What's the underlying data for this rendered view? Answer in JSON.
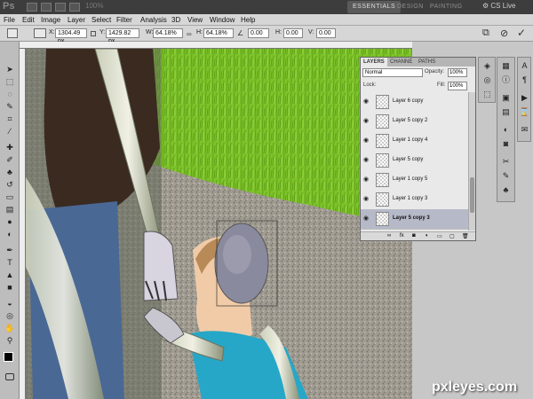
{
  "app": {
    "logo": "Ps",
    "zoom": "100%"
  },
  "workspaces": [
    "ESSENTIALS",
    "DESIGN",
    "PAINTING"
  ],
  "cs_live": "CS Live",
  "menus": [
    "File",
    "Edit",
    "Image",
    "Layer",
    "Select",
    "Filter",
    "Analysis",
    "3D",
    "View",
    "Window",
    "Help"
  ],
  "options": {
    "x_label": "X:",
    "x_value": "1304.49 px",
    "y_label": "Y:",
    "y_value": "1429.82 px",
    "w_label": "W:",
    "w_value": "64.18%",
    "h_label": "H:",
    "h_value": "64.18%",
    "rot_value": "0.00",
    "hskew_label": "H:",
    "hskew_value": "0.00",
    "vskew_label": "V:",
    "vskew_value": "0.00"
  },
  "layers_panel": {
    "tabs": [
      "LAYERS",
      "CHANNE",
      "PATHS"
    ],
    "blend_mode": "Normal",
    "opacity_label": "Opacity:",
    "opacity_value": "100%",
    "lock_label": "Lock:",
    "fill_label": "Fill:",
    "fill_value": "100%",
    "layers": [
      "Layer 6 copy",
      "Layer 5 copy 2",
      "Layer 1 copy 4",
      "Layer 5 copy",
      "Layer 1 copy 5",
      "Layer 1 copy 3",
      "Layer 5 copy 3"
    ],
    "selected_layer": "Layer 5 copy 3"
  },
  "watermark": "pxleyes.com",
  "colors": {
    "chrome_dark": "#3d3d3d",
    "panel_light": "#d6d6d6",
    "selection": "#b6b9c8"
  }
}
